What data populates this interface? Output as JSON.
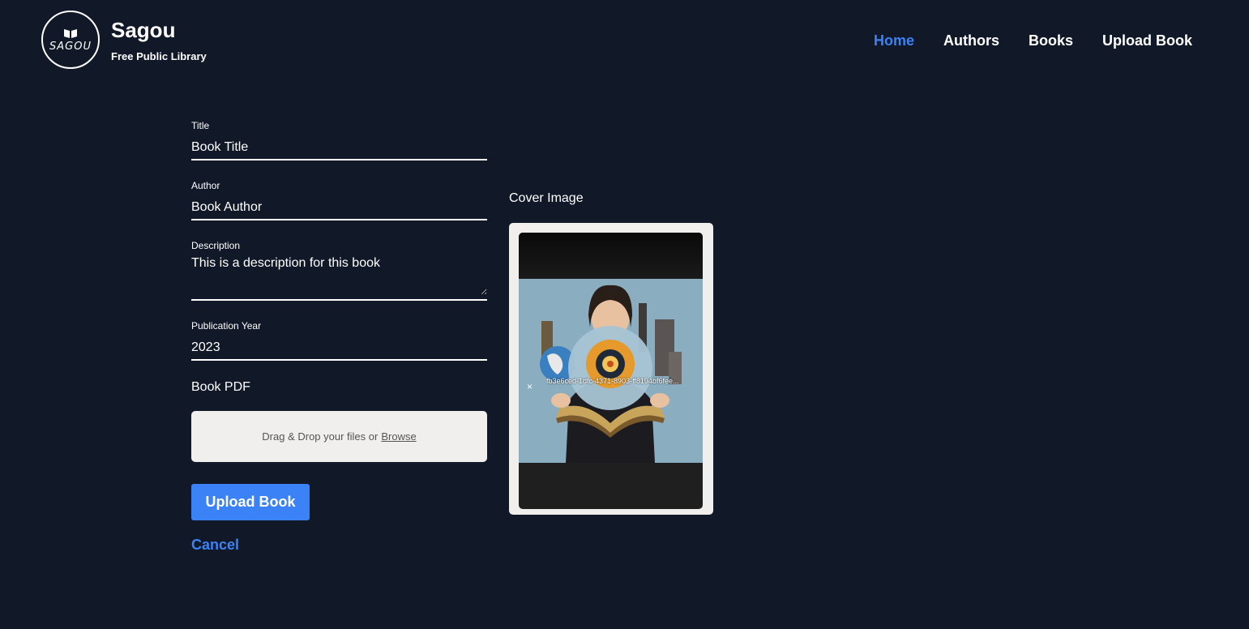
{
  "brand": {
    "logo_text": "SAGOU",
    "name": "Sagou",
    "tagline": "Free Public Library"
  },
  "nav": {
    "items": [
      {
        "label": "Home",
        "active": true
      },
      {
        "label": "Authors",
        "active": false
      },
      {
        "label": "Books",
        "active": false
      },
      {
        "label": "Upload Book",
        "active": false
      }
    ]
  },
  "form": {
    "title": {
      "label": "Title",
      "value": "Book Title"
    },
    "author": {
      "label": "Author",
      "value": "Book Author"
    },
    "description": {
      "label": "Description",
      "value": "This is a description for this book"
    },
    "year": {
      "label": "Publication Year",
      "value": "2023"
    },
    "pdf": {
      "label": "Book PDF",
      "drop_text": "Drag & Drop your files or",
      "browse_label": "Browse"
    },
    "submit_label": "Upload Book",
    "cancel_label": "Cancel"
  },
  "cover": {
    "label": "Cover Image",
    "remove_icon": "×",
    "file_name": "fb3e6ced-1dfc-4371-8903-ff8194bf6fee..."
  },
  "colors": {
    "background": "#111827",
    "accent": "#3b82f6",
    "panel": "#f0efed"
  }
}
